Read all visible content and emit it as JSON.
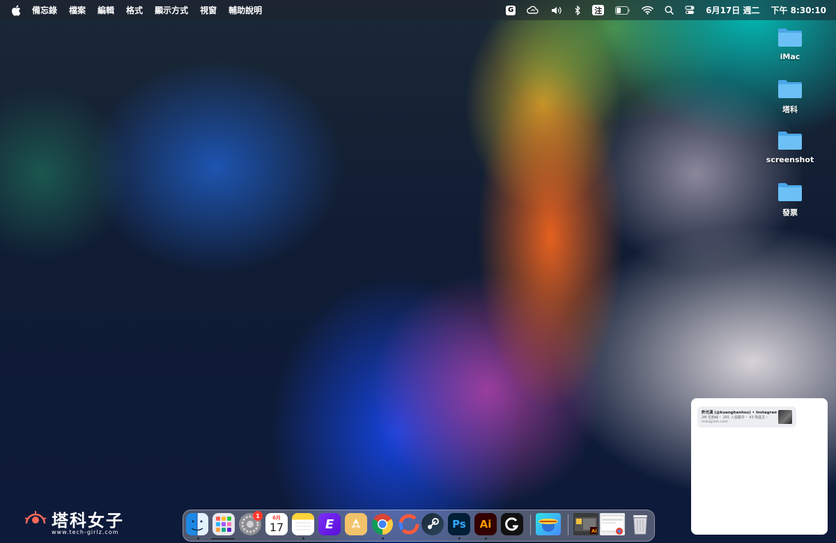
{
  "menubar": {
    "app_name": "備忘錄",
    "menus": [
      "檔案",
      "編輯",
      "格式",
      "顯示方式",
      "視窗",
      "輔助說明"
    ],
    "input_method": "注",
    "date": "6月17日 週二",
    "time": "下午 8:30:10",
    "status_icons": [
      "grammarly-icon",
      "cloud-sync-icon",
      "volume-icon",
      "bluetooth-icon",
      "input-method-icon",
      "battery-icon",
      "wifi-icon",
      "search-icon",
      "control-center-icon"
    ]
  },
  "desktop": {
    "items": [
      {
        "label": "iMac",
        "icon": "folder-icon"
      },
      {
        "label": "塔科",
        "icon": "folder-icon"
      },
      {
        "label": "screenshot",
        "icon": "folder-icon"
      },
      {
        "label": "發票",
        "icon": "folder-icon"
      }
    ],
    "folder_color": "#5bb4f0"
  },
  "widget": {
    "notification": {
      "title": "許光漢 (@kuanghanhsu) • Instagram...",
      "subtitle": "2M 位粉絲・ 281 人追蹤中・ 43 則貼文・",
      "source": "instagram.com"
    }
  },
  "watermark": {
    "name": "塔科女子",
    "url": "www.tech-girlz.com"
  },
  "dock": {
    "apps": [
      {
        "name": "Finder",
        "icon": "finder-icon",
        "running": true
      },
      {
        "name": "Launchpad",
        "icon": "launchpad-icon",
        "running": false
      },
      {
        "name": "System Settings",
        "icon": "settings-icon",
        "running": false,
        "badge": "1"
      },
      {
        "name": "Calendar",
        "icon": "calendar-icon",
        "running": false,
        "month": "6月",
        "day": "17"
      },
      {
        "name": "Notes",
        "icon": "notes-icon",
        "running": true
      },
      {
        "name": "E",
        "icon": "e-app-icon",
        "running": false
      },
      {
        "name": "Archive",
        "icon": "archive-icon",
        "running": false
      },
      {
        "name": "Chrome",
        "icon": "chrome-icon",
        "running": true
      },
      {
        "name": "Capture",
        "icon": "capture-icon",
        "running": false
      },
      {
        "name": "Steam",
        "icon": "steam-icon",
        "running": false
      },
      {
        "name": "Ps",
        "icon": "photoshop-icon",
        "running": true
      },
      {
        "name": "Ai",
        "icon": "illustrator-icon",
        "running": true
      },
      {
        "name": "G HUB",
        "icon": "logitech-icon",
        "running": false
      },
      {
        "name": "WORLDS",
        "icon": "worlds-icon",
        "running": false
      },
      {
        "name": "Ai Window",
        "icon": "illustrator-window-thumb",
        "running": false
      },
      {
        "name": "Chrome Window",
        "icon": "chrome-window-thumb",
        "running": false
      },
      {
        "name": "Trash",
        "icon": "trash-icon",
        "running": false
      }
    ],
    "photoshop_color": "#31a8ff",
    "illustrator_color": "#ff9a00",
    "badge_color": "#ff3b30"
  }
}
